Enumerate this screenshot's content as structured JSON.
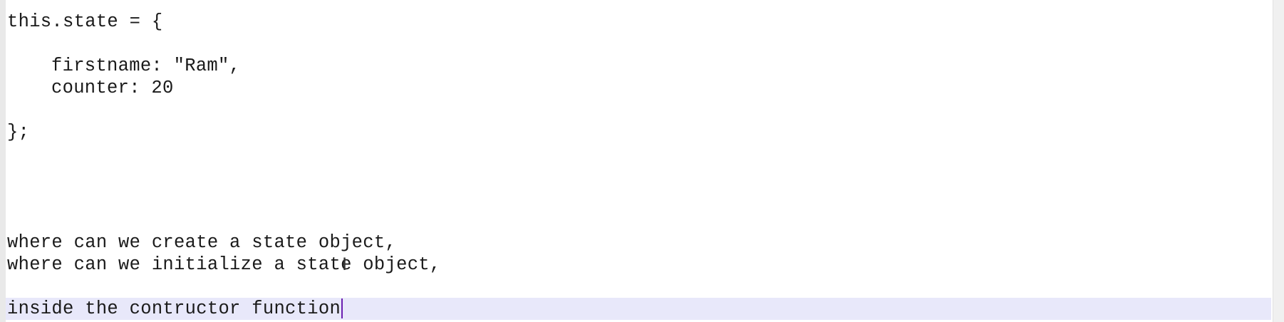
{
  "editor": {
    "lines": [
      "this.state = {",
      "",
      "firstname: \"Ram\",",
      "counter: 20",
      "",
      "};",
      "",
      "",
      "",
      "",
      "where can we create a state object,",
      "where can we initialize a state object,",
      "",
      "inside the contructor function"
    ]
  },
  "icons": {
    "text_cursor": "i-beam-cursor-icon"
  }
}
